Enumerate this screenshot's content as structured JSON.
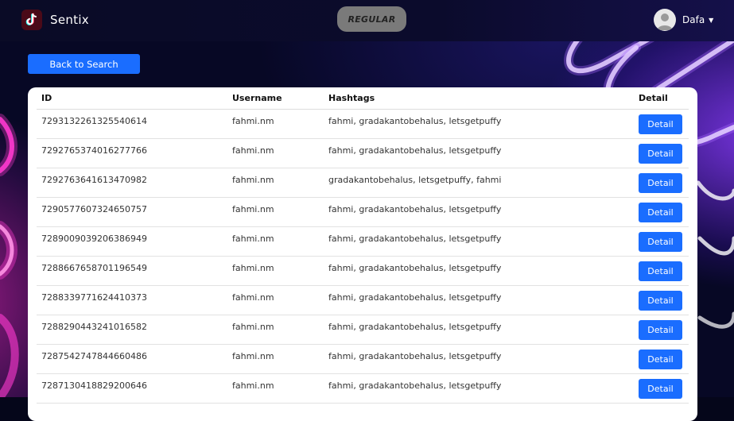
{
  "app": {
    "name": "Sentix"
  },
  "plan_badge": "REGULAR",
  "user": {
    "name": "Dafa"
  },
  "back_button": "Back to Search",
  "table": {
    "headers": {
      "id": "ID",
      "username": "Username",
      "hashtags": "Hashtags",
      "detail": "Detail"
    },
    "rows": [
      {
        "id": "7293132261325540614",
        "username": "fahmi.nm",
        "hashtags": "fahmi, gradakantobehalus, letsgetpuffy",
        "action": "Detail"
      },
      {
        "id": "7292765374016277766",
        "username": "fahmi.nm",
        "hashtags": "fahmi, gradakantobehalus, letsgetpuffy",
        "action": "Detail"
      },
      {
        "id": "7292763641613470982",
        "username": "fahmi.nm",
        "hashtags": "gradakantobehalus, letsgetpuffy, fahmi",
        "action": "Detail"
      },
      {
        "id": "7290577607324650757",
        "username": "fahmi.nm",
        "hashtags": "fahmi, gradakantobehalus, letsgetpuffy",
        "action": "Detail"
      },
      {
        "id": "7289009039206386949",
        "username": "fahmi.nm",
        "hashtags": "fahmi, gradakantobehalus, letsgetpuffy",
        "action": "Detail"
      },
      {
        "id": "7288667658701196549",
        "username": "fahmi.nm",
        "hashtags": "fahmi, gradakantobehalus, letsgetpuffy",
        "action": "Detail"
      },
      {
        "id": "7288339771624410373",
        "username": "fahmi.nm",
        "hashtags": "fahmi, gradakantobehalus, letsgetpuffy",
        "action": "Detail"
      },
      {
        "id": "7288290443241016582",
        "username": "fahmi.nm",
        "hashtags": "fahmi, gradakantobehalus, letsgetpuffy",
        "action": "Detail"
      },
      {
        "id": "7287542747844660486",
        "username": "fahmi.nm",
        "hashtags": "fahmi, gradakantobehalus, letsgetpuffy",
        "action": "Detail"
      },
      {
        "id": "7287130418829200646",
        "username": "fahmi.nm",
        "hashtags": "fahmi, gradakantobehalus, letsgetpuffy",
        "action": "Detail"
      }
    ]
  },
  "colors": {
    "primary": "#1a6dff",
    "navbar": "#0b0b2c",
    "plan_badge": "#7a7a7a",
    "neon_pink": "#ff3ad0",
    "neon_purple": "#8a40ff"
  }
}
